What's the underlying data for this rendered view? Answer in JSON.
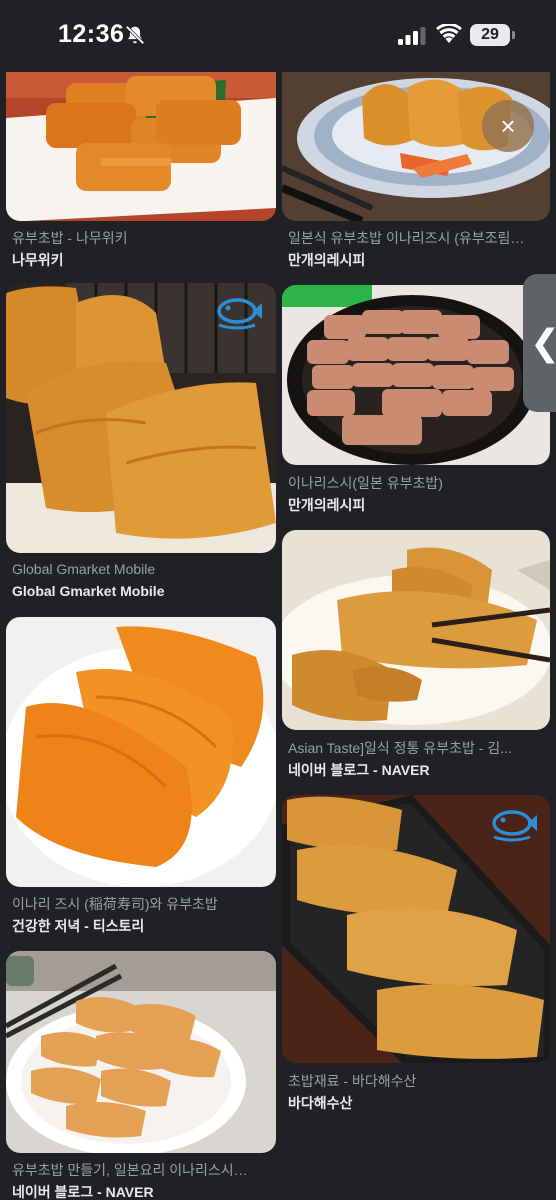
{
  "status_bar": {
    "time": "12:36",
    "battery": "29",
    "icons": [
      "bell-slash-icon",
      "signal-icon",
      "wifi-icon",
      "battery-icon"
    ]
  },
  "overlay": {
    "close_symbol": "×",
    "side_handle_symbol": "❮"
  },
  "results": [
    {
      "title": "유부초밥 - 나무위키",
      "source": "나무위키"
    },
    {
      "title": "일본식 유부초밥 이나리즈시 (유부조림…",
      "source": "만개의레시피"
    },
    {
      "title": "Global Gmarket Mobile",
      "source": "Global Gmarket Mobile"
    },
    {
      "title": "이나리스시(일본 유부초밥)",
      "source": "만개의레시피"
    },
    {
      "title": "이나리 즈시 (稲荷寿司)와 유부초밥",
      "source": "건강한 저녁 - 티스토리"
    },
    {
      "title": "Asian Taste]일식 정통 유부초밥 - 김...",
      "source": "네이버 블로그 - NAVER"
    },
    {
      "title": "초밥재료 - 바다해수산",
      "source": "바다해수산"
    },
    {
      "title": "유부초밥 만들기, 일본요리 이나리스시…",
      "source": "네이버 블로그 - NAVER"
    }
  ],
  "colors": {
    "background": "#202124",
    "caption": "#9aa0a6",
    "source": "#e8eaed",
    "tofu": "#e8962e"
  }
}
